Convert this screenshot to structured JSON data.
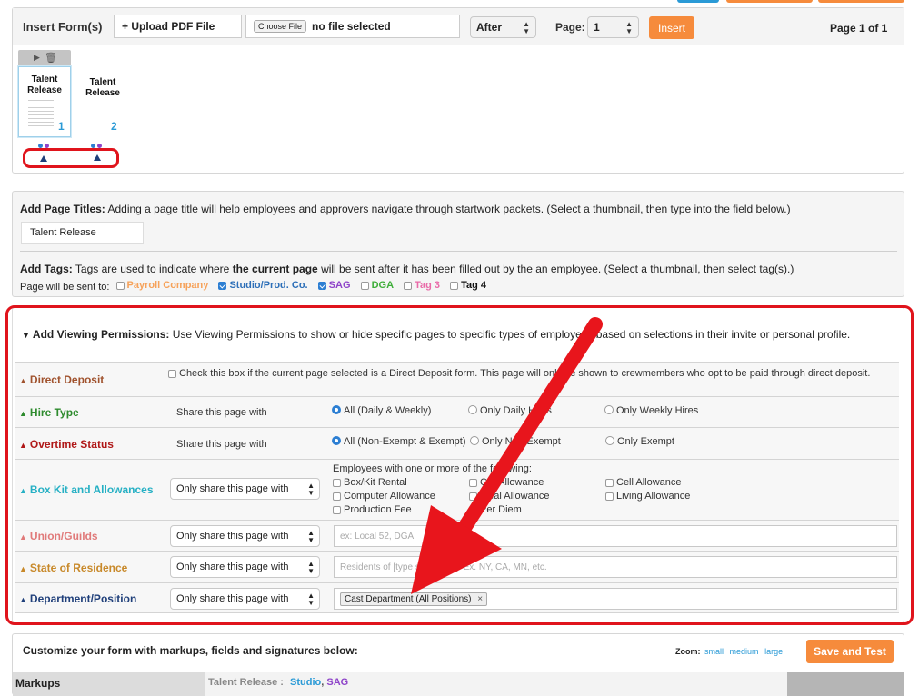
{
  "insert_row": {
    "label": "Insert Form(s)",
    "upload_label": "+ Upload PDF File",
    "choose_file_label": "Choose File",
    "file_status": "no file selected",
    "position_value": "After",
    "page_label": "Page:",
    "page_value": "1",
    "insert_label": "Insert",
    "page_indicator": "Page 1 of 1"
  },
  "thumbnails": [
    {
      "title": "Talent Release",
      "number": "1"
    },
    {
      "title": "Talent Release",
      "number": "2"
    }
  ],
  "page_titles": {
    "heading": "Add Page Titles:",
    "description": "Adding a page title will help employees and approvers navigate through startwork packets. (Select a thumbnail, then type into the field below.)",
    "value": "Talent Release"
  },
  "tags": {
    "heading": "Add Tags:",
    "description_before": "Tags are used to indicate where",
    "description_bold": "the current page",
    "description_after": "will be sent after it has been filled out by the an employee. (Select a thumbnail, then select tag(s).)",
    "sent_to_label": "Page will be sent to:",
    "items": [
      {
        "label": "Payroll Company",
        "checked": false,
        "color": "#f6a25a"
      },
      {
        "label": "Studio/Prod. Co.",
        "checked": true,
        "color": "#2d6fb8"
      },
      {
        "label": "SAG",
        "checked": true,
        "color": "#8e44c9"
      },
      {
        "label": "DGA",
        "checked": false,
        "color": "#3fae3a"
      },
      {
        "label": "Tag 3",
        "checked": false,
        "color": "#e96aa8"
      },
      {
        "label": "Tag 4",
        "checked": false,
        "color": "#111111"
      }
    ]
  },
  "permissions": {
    "heading": "Add Viewing Permissions:",
    "description": "Use Viewing Permissions to show or hide specific pages to specific types of employees based on selections in their invite or personal profile.",
    "direct_deposit": {
      "label": "Direct Deposit",
      "color": "#a0522d",
      "text": "Check this box if the current page selected is a Direct Deposit form. This page will only be shown to crewmembers who opt to be paid through direct deposit."
    },
    "hire_type": {
      "label": "Hire Type",
      "color": "#2e8b2e",
      "share": "Share this page with",
      "options": [
        "All (Daily & Weekly)",
        "Only Daily Hires",
        "Only Weekly Hires"
      ]
    },
    "overtime": {
      "label": "Overtime Status",
      "color": "#b01818",
      "share": "Share this page with",
      "options": [
        "All (Non-Exempt & Exempt)",
        "Only Non-Exempt",
        "Only Exempt"
      ]
    },
    "box_kit": {
      "label": "Box Kit and Allowances",
      "color": "#26b0c4",
      "select": "Only share this page with",
      "intro": "Employees with one or more of the following:",
      "options": [
        "Box/Kit Rental",
        "Car Allowance",
        "Cell Allowance",
        "Computer Allowance",
        "Meal Allowance",
        "Living Allowance",
        "Production Fee",
        "Per Diem"
      ]
    },
    "union": {
      "label": "Union/Guilds",
      "color": "#e07a7a",
      "select": "Only share this page with",
      "placeholder": "ex: Local 52, DGA"
    },
    "state": {
      "label": "State of Residence",
      "color": "#c8892a",
      "select": "Only share this page with",
      "placeholder": "Residents of [type state here]. Ex. NY, CA, MN, etc."
    },
    "department": {
      "label": "Department/Position",
      "color": "#1f3f7a",
      "select": "Only share this page with",
      "chip": "Cast Department (All Positions)",
      "chip_close": "×"
    }
  },
  "customize": {
    "text": "Customize your form with markups, fields and signatures below:",
    "zoom_label": "Zoom:",
    "zoom_options": [
      "small",
      "medium",
      "large"
    ],
    "save_label": "Save and Test"
  },
  "bottom": {
    "markups_label": "Markups",
    "doc_title": "Talent Release :",
    "doc_tag1": "Studio",
    "doc_sep": ",",
    "doc_tag2": "SAG"
  }
}
